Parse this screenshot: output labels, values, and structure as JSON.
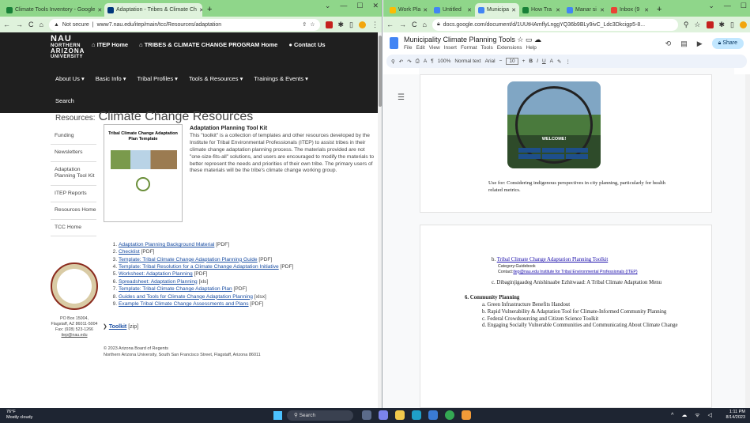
{
  "left_browser": {
    "tabs": [
      {
        "label": "Climate Tools Inventory - Google",
        "active": false
      },
      {
        "label": "Adaptation - Tribes & Climate Ch",
        "active": true
      }
    ],
    "address": {
      "security": "Not secure",
      "url": "www7.nau.edu/itep/main/tcc/Resources/adaptation"
    },
    "page": {
      "logo": {
        "line1": "NAU",
        "line2": "NORTHERN",
        "line3": "ARIZONA",
        "line4": "UNIVERSITY"
      },
      "top_nav": [
        "ITEP Home",
        "TRIBES & CLIMATE CHANGE PROGRAM Home",
        "Contact Us"
      ],
      "main_menu": [
        "About Us",
        "Basic Info",
        "Tribal Profiles",
        "Tools & Resources",
        "Trainings & Events"
      ],
      "search": "Search",
      "heading_prefix": "Resources:",
      "heading": "Climate Change Resources",
      "side_menu": [
        "Funding",
        "Newsletters",
        "Adaptation Planning Tool Kit",
        "ITEP Reports",
        "Resources Home",
        "TCC Home"
      ],
      "thumbnail_title": "Tribal Climate Change Adaptation Plan Template",
      "intro_heading": "Adaptation Planning Tool Kit",
      "intro_text": "This \"toolkit\" is a collection of templates and other resources developed by the Institute for Tribal Environmental Professionals (ITEP) to assist tribes in their climate change adaptation planning process. The materials provided are not \"one-size-fits-all\" solutions, and users are encouraged to modify the materials to better represent the needs and priorities of their own tribe. The primary users of these materials will be the tribe's climate change working group.",
      "resources": [
        {
          "link": "Adaptation Planning Background Material",
          "type": "[PDF]"
        },
        {
          "link": "Checklist",
          "type": "[PDF]"
        },
        {
          "link": "Template: Tribal Climate Change Adaptation Planning Guide",
          "type": "[PDF]"
        },
        {
          "link": "Template: Tribal Resolution for a Climate Change Adaptation Initiative",
          "type": "[PDF]"
        },
        {
          "link": "Worksheet: Adaptation Planning",
          "type": "[PDF]"
        },
        {
          "link": "Spreadsheet: Adaptation Planning",
          "type": "[xls]"
        },
        {
          "link": "Template: Tribal Climate Change Adaptation Plan",
          "type": "[PDF]"
        },
        {
          "link": "Guides and Tools for Climate Change Adaptation Planning",
          "type": "[xlsx]"
        },
        {
          "link": "Example Tribal Climate Change Assessments and Plans",
          "type": "[PDF]"
        }
      ],
      "toolkit_link": "Toolkit",
      "toolkit_type": "[zip]",
      "address_lines": [
        "PO Box 15004,",
        "Flagstaff, AZ 86011-5004",
        "Fax: (928) 523-1266",
        "itep@nau.edu"
      ],
      "footer_lines": [
        "© 2023 Arizona Board of Regents",
        "Northern Arizona University, South San Francisco Street, Flagstaff, Arizona 86011"
      ]
    }
  },
  "right_browser": {
    "tabs": [
      {
        "label": "Work Pla",
        "active": false
      },
      {
        "label": "Untitled",
        "active": false
      },
      {
        "label": "Municipa",
        "active": true
      },
      {
        "label": "How Tra",
        "active": false
      },
      {
        "label": "Manar si",
        "active": false
      },
      {
        "label": "Inbox (9",
        "active": false
      }
    ],
    "address": {
      "url": "docs.google.com/document/d/1UUtHAmflyLnggYQ36b9BLy9ivC_Ldc3Dkcigp5-8..."
    },
    "docs": {
      "title": "Municipality Climate Planning Tools",
      "menu": [
        "File",
        "Edit",
        "View",
        "Insert",
        "Format",
        "Tools",
        "Extensions",
        "Help"
      ],
      "share": "Share",
      "toolbar": {
        "zoom": "100%",
        "style": "Normal text",
        "font": "Arial",
        "size": "10"
      },
      "photo_label": "WELCOME!",
      "use_for": "Use for: Considering indigenous perspectives in city planning, particularly for health related metrics.",
      "item_b_label": "b.",
      "item_b_link": "Tribal Climate Change Adaptation Planning Toolkit",
      "item_b_category": "Category:Guidebook",
      "item_b_contact_prefix": "Contact:",
      "item_b_contact_link": "itep@nau.edu Institute for Tribal Environmental Professionals (ITEP)",
      "item_c": "c.  Dibaginjigaadeg Anishinaabe Ezhitwaad: A Tribal Climate Adaptation Menu",
      "section_6": "6.  Community Planning",
      "section_6_items": [
        "a.  Green Infrastructure Benefits Handout",
        "b.  Rapid Vulnerability & Adaptation Tool for Climate-Informed Community Planning",
        "c.  Federal Crowdsourcing and Citizen Science Toolkit",
        "d.  Engaging Socially Vulnerable Communities and Communicating About Climate Change"
      ]
    }
  },
  "taskbar": {
    "weather_temp": "76°F",
    "weather_desc": "Mostly cloudy",
    "search": "Search",
    "time": "1:11 PM",
    "date": "8/14/2023"
  },
  "colors": {
    "tabstrip": "#8fd68a",
    "nau_nav": "#1f1f1f",
    "link": "#1a4ea3",
    "taskbar": "#1e2532"
  }
}
